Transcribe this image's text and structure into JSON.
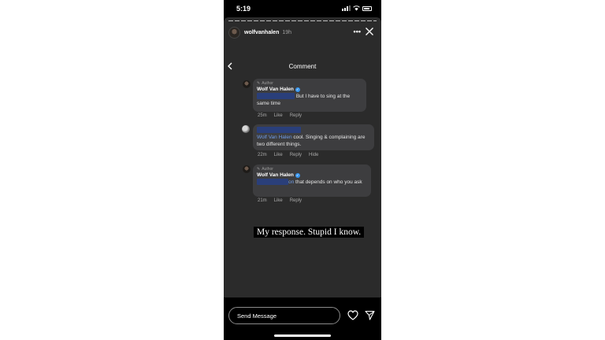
{
  "status_bar": {
    "time": "5:19"
  },
  "story": {
    "username": "wolfvanhalen",
    "time_ago": "19h",
    "caption": "My response. Stupid I know."
  },
  "comment_screen": {
    "title": "Comment",
    "comments": [
      {
        "author_tag": "Author",
        "name": "Wolf Van Halen",
        "text": "But I have to sing at the same time",
        "time": "25m",
        "actions": [
          "Like",
          "Reply"
        ]
      },
      {
        "mention": "Wolf Van Halen",
        "text": "cool. Singing & complaining are two different things.",
        "time": "22m",
        "actions": [
          "Like",
          "Reply",
          "Hide"
        ]
      },
      {
        "author_tag": "Author",
        "name": "Wolf Van Halen",
        "mention_tail": "on",
        "text": "that depends on who you ask",
        "time": "21m",
        "actions": [
          "Like",
          "Reply"
        ]
      }
    ]
  },
  "bottom_bar": {
    "placeholder": "Send Message"
  },
  "colors": {
    "story_bg": "#2b2b2b",
    "bubble_bg": "#3d3d3f",
    "mention": "#6e9ce8",
    "verified": "#3897f0",
    "redaction": "#2a3f7a"
  }
}
